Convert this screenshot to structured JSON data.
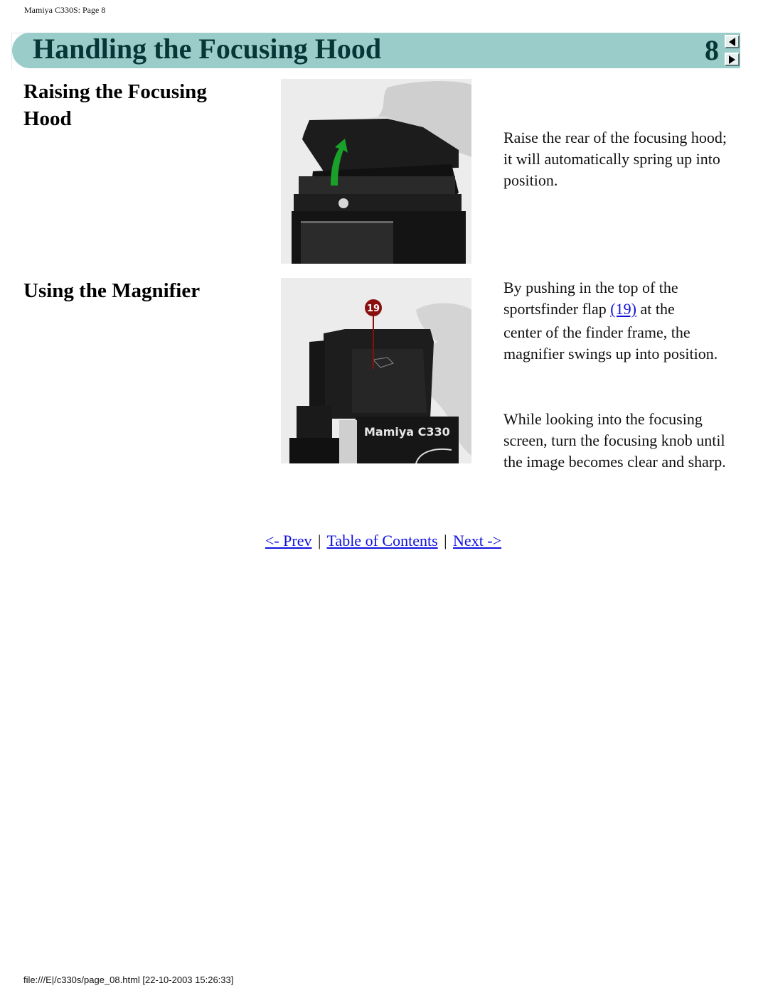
{
  "page_header": "Mamiya C330S: Page 8",
  "banner": {
    "title": "Handling the Focusing Hood",
    "page_number": "8",
    "prev_arrow_icon": "triangle-left",
    "next_arrow_icon": "triangle-right",
    "color": "#9accca",
    "text_color": "#063635"
  },
  "sections": [
    {
      "heading": "Raising the Focusing Hood",
      "image_alt": "Hand raising the rear of the camera focusing hood with green arrow",
      "paragraphs": [
        "Raise the rear of the focusing hood; it will automatically spring up into position."
      ]
    },
    {
      "heading": "Using the Magnifier",
      "image_alt": "Hand pushing sportsfinder flap, callout 19, Mamiya C330 camera",
      "image_callout": "19",
      "image_brand_text": "Mamiya C330",
      "paragraph1": {
        "before_link": "By pushing in the top of the sportsfinder flap ",
        "link_text": "(19)",
        "after_link": " at the",
        "rest": "center of the finder frame, the magnifier swings up into position."
      },
      "paragraph2": "While looking into the focusing screen, turn the focusing knob until the image becomes clear and sharp."
    }
  ],
  "nav": {
    "prev": "<- Prev",
    "toc": "Table of Contents",
    "next": "Next ->",
    "separator": "|",
    "link_color": "#1010dd"
  },
  "footer_url": "file:///E|/c330s/page_08.html [22-10-2003 15:26:33]"
}
